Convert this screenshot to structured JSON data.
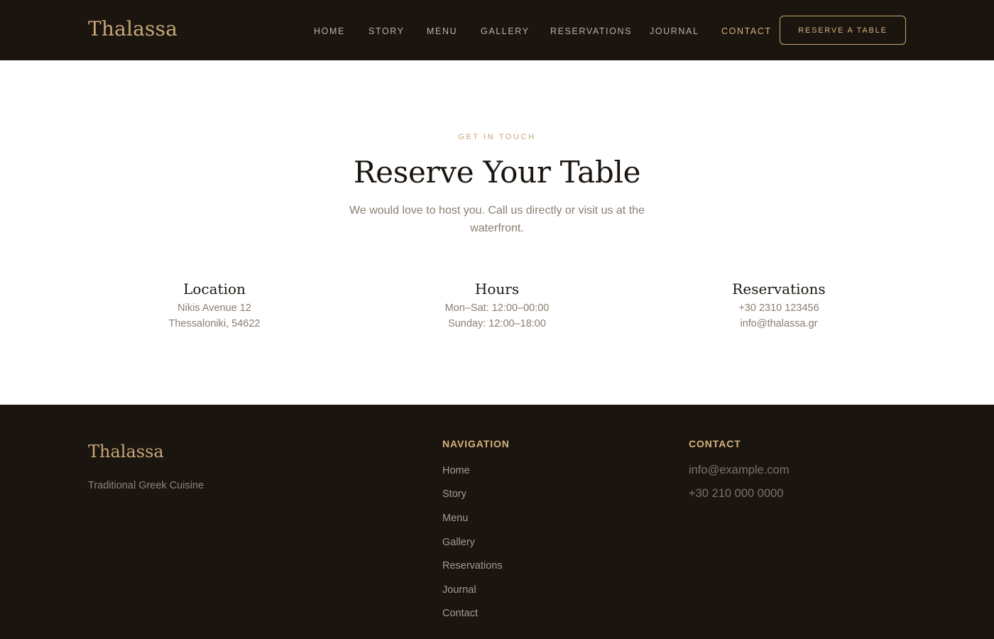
{
  "header": {
    "brand": "Thalassa",
    "nav": [
      "HOME",
      "STORY",
      "MENU",
      "GALLERY",
      "RESERVATIONS",
      "JOURNAL",
      "CONTACT"
    ],
    "active_nav": "CONTACT",
    "cta_label": "RESERVE A TABLE"
  },
  "hero": {
    "eyebrow": "GET IN TOUCH",
    "title": "Reserve Your Table",
    "intro": "We would love to host you. Call us directly or visit us at the waterfront."
  },
  "info": [
    {
      "title": "Location",
      "lines": [
        "Nikis Avenue 12",
        "Thessaloniki, 54622"
      ]
    },
    {
      "title": "Hours",
      "lines": [
        "Mon–Sat: 12:00–00:00",
        "Sunday: 12:00–18:00"
      ]
    },
    {
      "title": "Reservations",
      "lines": [
        "+30 2310 123456",
        "info@thalassa.gr"
      ]
    }
  ],
  "footer": {
    "brand": "Thalassa",
    "tagline": "Traditional Greek Cuisine",
    "nav_heading": "NAVIGATION",
    "nav_links": [
      "Home",
      "Story",
      "Menu",
      "Gallery",
      "Reservations",
      "Journal",
      "Contact"
    ],
    "contact_heading": "CONTACT",
    "email": "info@example.com",
    "phone": "+30 210 000 0000"
  },
  "colors": {
    "dark_background": "#1b1510",
    "accent_gold": "#c7a777",
    "muted_text": "#8a7e70"
  }
}
